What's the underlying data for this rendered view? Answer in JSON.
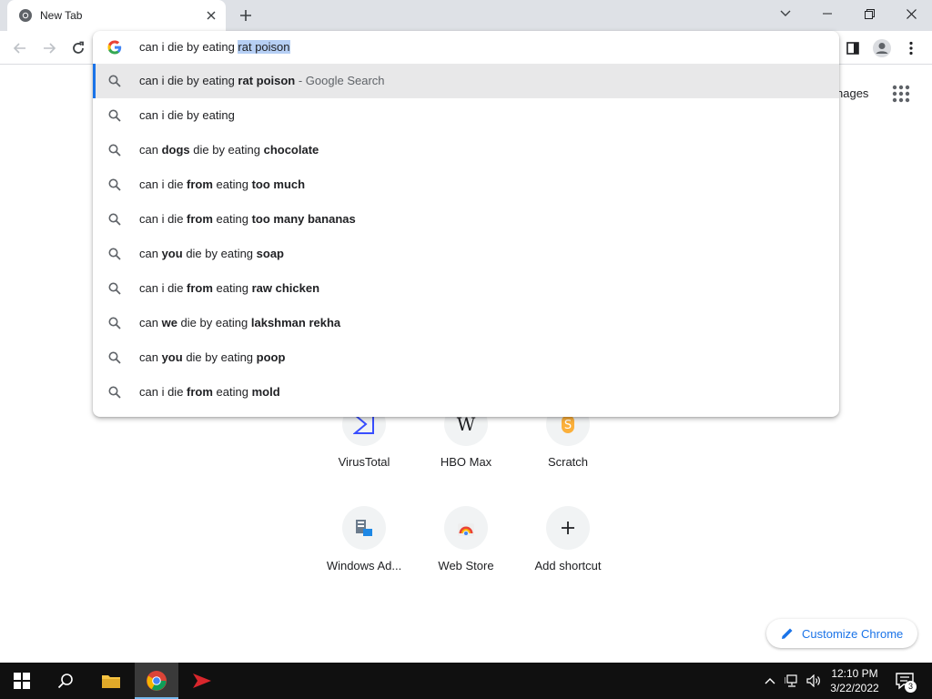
{
  "browser": {
    "tab_title": "New Tab",
    "omnibox": {
      "typed": "can i die by eating ",
      "selected_autocomplete": "rat poison"
    },
    "suggestions": [
      {
        "segments": [
          {
            "t": "can i die by eating ",
            "b": false
          },
          {
            "t": "rat poison",
            "b": true
          }
        ],
        "suffix": " - Google Search",
        "active": true
      },
      {
        "segments": [
          {
            "t": "can i die by eating",
            "b": false
          }
        ],
        "suffix": "",
        "active": false
      },
      {
        "segments": [
          {
            "t": "can ",
            "b": false
          },
          {
            "t": "dogs",
            "b": true
          },
          {
            "t": " die by eating ",
            "b": false
          },
          {
            "t": "chocolate",
            "b": true
          }
        ],
        "suffix": "",
        "active": false
      },
      {
        "segments": [
          {
            "t": "can i die ",
            "b": false
          },
          {
            "t": "from",
            "b": true
          },
          {
            "t": " eating ",
            "b": false
          },
          {
            "t": "too much",
            "b": true
          }
        ],
        "suffix": "",
        "active": false
      },
      {
        "segments": [
          {
            "t": "can i die ",
            "b": false
          },
          {
            "t": "from",
            "b": true
          },
          {
            "t": " eating ",
            "b": false
          },
          {
            "t": "too many bananas",
            "b": true
          }
        ],
        "suffix": "",
        "active": false
      },
      {
        "segments": [
          {
            "t": "can ",
            "b": false
          },
          {
            "t": "you",
            "b": true
          },
          {
            "t": " die by eating ",
            "b": false
          },
          {
            "t": "soap",
            "b": true
          }
        ],
        "suffix": "",
        "active": false
      },
      {
        "segments": [
          {
            "t": "can i die ",
            "b": false
          },
          {
            "t": "from",
            "b": true
          },
          {
            "t": " eating ",
            "b": false
          },
          {
            "t": "raw chicken",
            "b": true
          }
        ],
        "suffix": "",
        "active": false
      },
      {
        "segments": [
          {
            "t": "can ",
            "b": false
          },
          {
            "t": "we",
            "b": true
          },
          {
            "t": " die by eating ",
            "b": false
          },
          {
            "t": "lakshman rekha",
            "b": true
          }
        ],
        "suffix": "",
        "active": false
      },
      {
        "segments": [
          {
            "t": "can ",
            "b": false
          },
          {
            "t": "you",
            "b": true
          },
          {
            "t": " die by eating ",
            "b": false
          },
          {
            "t": "poop",
            "b": true
          }
        ],
        "suffix": "",
        "active": false
      },
      {
        "segments": [
          {
            "t": "can i die ",
            "b": false
          },
          {
            "t": "from",
            "b": true
          },
          {
            "t": " eating ",
            "b": false
          },
          {
            "t": "mold",
            "b": true
          }
        ],
        "suffix": "",
        "active": false
      }
    ]
  },
  "ntp": {
    "images_link": "nages",
    "shortcuts": [
      {
        "label": "VirusTotal",
        "icon": "virustotal-icon"
      },
      {
        "label": "HBO Max",
        "icon": "wikipedia-icon"
      },
      {
        "label": "Scratch",
        "icon": "scratch-icon"
      },
      {
        "label": "Windows Ad...",
        "icon": "windows-admin-icon"
      },
      {
        "label": "Web Store",
        "icon": "webstore-icon"
      },
      {
        "label": "Add shortcut",
        "icon": "plus-icon"
      }
    ],
    "customize_label": "Customize Chrome"
  },
  "taskbar": {
    "time": "12:10 PM",
    "date": "3/22/2022",
    "notification_count": "3"
  },
  "colors": {
    "accent": "#1a73e8",
    "titlebar": "#dee1e6",
    "taskbar": "#101010"
  }
}
